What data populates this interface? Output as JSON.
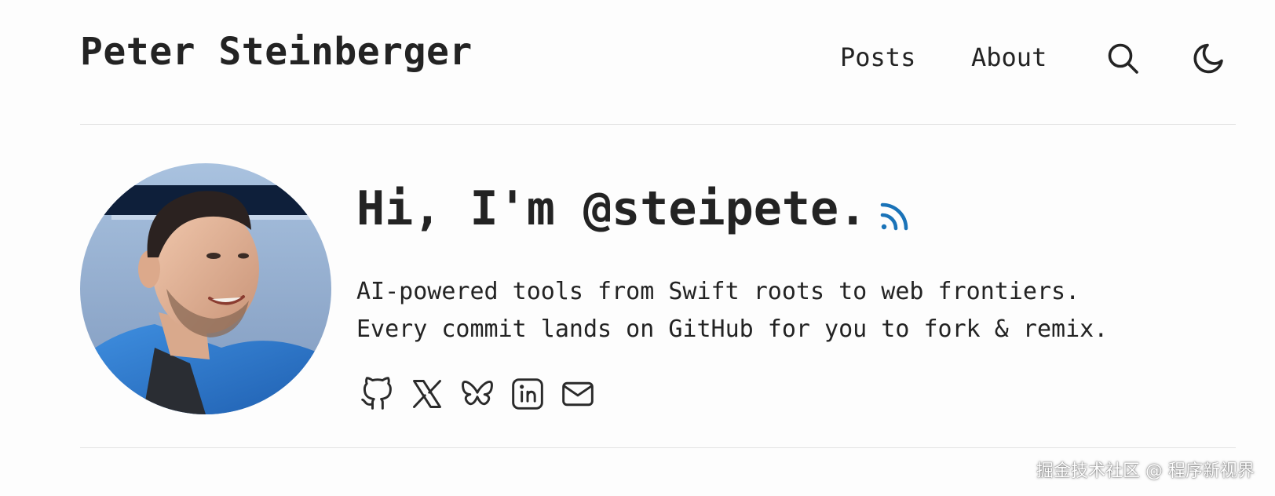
{
  "header": {
    "site_title": "Peter Steinberger",
    "nav": [
      {
        "label": "Posts"
      },
      {
        "label": "About"
      }
    ],
    "search_icon": "search-icon",
    "theme_icon": "moon-icon"
  },
  "profile": {
    "greeting": "Hi, I'm @steipete.",
    "rss_icon": "rss-icon",
    "rss_color": "#1a73b8",
    "bio_lines": [
      "AI-powered tools from Swift roots to web frontiers.",
      "Every commit lands on GitHub for you to fork & remix."
    ],
    "socials": [
      {
        "icon": "github-icon"
      },
      {
        "icon": "x-icon"
      },
      {
        "icon": "bluesky-icon"
      },
      {
        "icon": "linkedin-icon"
      },
      {
        "icon": "mail-icon"
      }
    ]
  },
  "watermark": "掘金技术社区 @ 程序新视界"
}
